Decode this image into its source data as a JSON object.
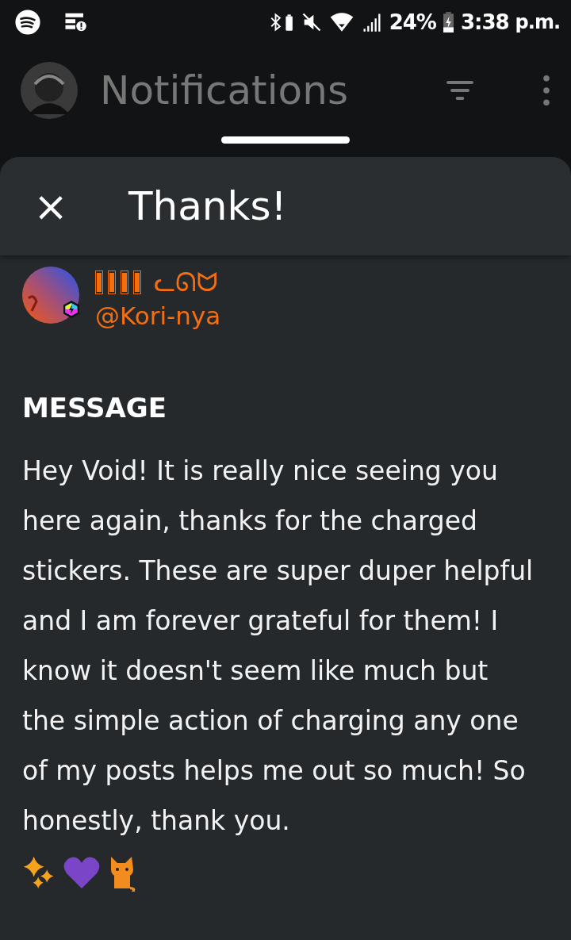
{
  "status_bar": {
    "battery": "24%",
    "time": "3:38",
    "ampm": "p.m."
  },
  "app_bar": {
    "title": "Notifications"
  },
  "sheet": {
    "title": "Thanks!",
    "close": "×"
  },
  "sender": {
    "display_name": [
      {
        "kind": "missing_glyph"
      },
      {
        "kind": "missing_glyph"
      },
      {
        "kind": "missing_glyph"
      },
      {
        "kind": "missing_glyph"
      },
      {
        "kind": "text",
        "text": "ᓚᘏᗢ"
      }
    ],
    "handle": "@Kori-nya"
  },
  "message": {
    "heading": "MESSAGE",
    "text": "Hey Void! It is really nice seeing you here again, thanks for the charged stickers. These are super duper helpful and I am forever grateful for them! I know it doesn't seem like much but the simple action of charging any one of my posts helps me out so much! So honestly, thank you."
  }
}
